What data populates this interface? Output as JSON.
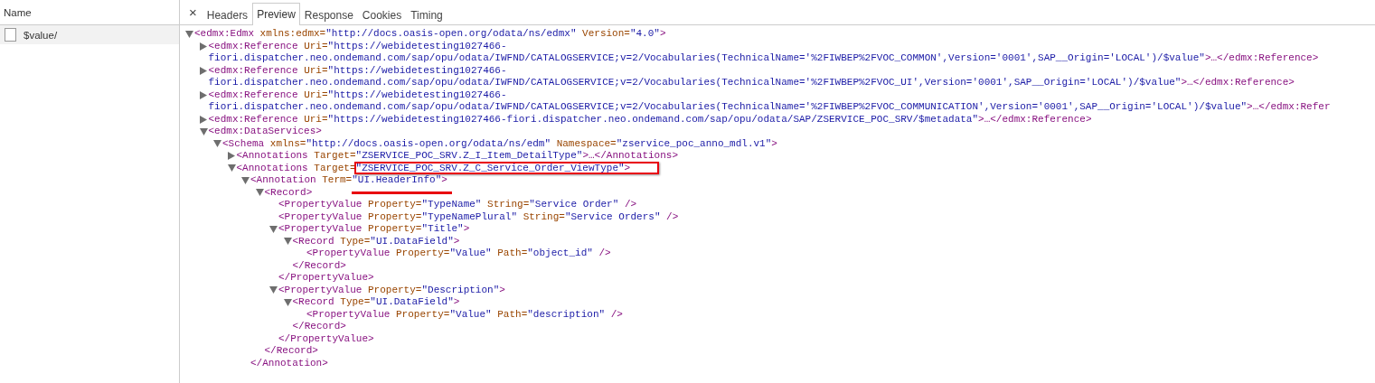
{
  "requests": {
    "column": "Name",
    "items": [
      {
        "name": "$value/",
        "selected": true
      }
    ]
  },
  "tabs": {
    "close": "×",
    "items": [
      {
        "label": "Headers",
        "selected": false
      },
      {
        "label": "Preview",
        "selected": true
      },
      {
        "label": "Response",
        "selected": false
      },
      {
        "label": "Cookies",
        "selected": false
      },
      {
        "label": "Timing",
        "selected": false
      }
    ]
  },
  "document": {
    "expanded": true,
    "tag": "<edmx:Edmx",
    "attrs": [
      {
        "name": "xmlns:edmx=",
        "value": "\"http://docs.oasis-open.org/odata/ns/edmx\""
      },
      {
        "name": "Version=",
        "value": "\"4.0\""
      }
    ],
    "end": ">",
    "children": [
      {
        "expanded": false,
        "tag": "<edmx:Reference",
        "attrs": [
          {
            "name": "Uri=",
            "value": "\"https://webidetesting1027466-fiori.dispatcher.neo.ondemand.com/sap/opu/odata/IWFND/CATALOGSERVICE;v=2/Vocabularies(TechnicalName='%2FIWBEP%2FVOC_COMMON',Version='0001',SAP__Origin='LOCAL')/$value\""
          }
        ],
        "end": ">…</edmx:Reference>"
      },
      {
        "expanded": false,
        "tag": "<edmx:Reference",
        "attrs": [
          {
            "name": "Uri=",
            "value": "\"https://webidetesting1027466-fiori.dispatcher.neo.ondemand.com/sap/opu/odata/IWFND/CATALOGSERVICE;v=2/Vocabularies(TechnicalName='%2FIWBEP%2FVOC_UI',Version='0001',SAP__Origin='LOCAL')/$value\""
          }
        ],
        "end": ">…</edmx:Reference>"
      },
      {
        "expanded": false,
        "tag": "<edmx:Reference",
        "attrs": [
          {
            "name": "Uri=",
            "value": "\"https://webidetesting1027466-fiori.dispatcher.neo.ondemand.com/sap/opu/odata/IWFND/CATALOGSERVICE;v=2/Vocabularies(TechnicalName='%2FIWBEP%2FVOC_COMMUNICATION',Version='0001',SAP__Origin='LOCAL')/$value\""
          }
        ],
        "end": ">…</edmx:Refer"
      },
      {
        "expanded": false,
        "tag": "<edmx:Reference",
        "attrs": [
          {
            "name": "Uri=",
            "value": "\"https://webidetesting1027466-fiori.dispatcher.neo.ondemand.com/sap/opu/odata/SAP/ZSERVICE_POC_SRV/$metadata\""
          }
        ],
        "end": ">…</edmx:Reference>"
      },
      {
        "expanded": true,
        "tag": "<edmx:DataServices",
        "end": ">",
        "children": [
          {
            "expanded": true,
            "tag": "<Schema",
            "attrs": [
              {
                "name": "xmlns=",
                "value": "\"http://docs.oasis-open.org/odata/ns/edm\""
              },
              {
                "name": "Namespace=",
                "value": "\"zservice_poc_anno_mdl.v1\""
              }
            ],
            "end": ">",
            "children": [
              {
                "expanded": false,
                "tag": "<Annotations",
                "attrs": [
                  {
                    "name": "Target=",
                    "value": "\"ZSERVICE_POC_SRV.Z_I_Item_DetailType\""
                  }
                ],
                "end": ">…</Annotations>"
              },
              {
                "expanded": true,
                "tag": "<Annotations",
                "attrs": [
                  {
                    "name": "Target=",
                    "value": "\"ZSERVICE_POC_SRV.Z_C_Service_Order_ViewType\"",
                    "boxed": true
                  }
                ],
                "end": ">",
                "children": [
                  {
                    "expanded": true,
                    "tag": "<Annotation",
                    "attrs": [
                      {
                        "name": "Term=",
                        "value": "\"UI.HeaderInfo\"",
                        "underlined": true
                      }
                    ],
                    "end": ">",
                    "children": [
                      {
                        "expanded": true,
                        "tag": "<Record",
                        "end": ">",
                        "children": [
                          {
                            "tag": "<PropertyValue",
                            "attrs": [
                              {
                                "name": "Property=",
                                "value": "\"TypeName\""
                              },
                              {
                                "name": "String=",
                                "value": "\"Service Order\""
                              }
                            ],
                            "end": " />"
                          },
                          {
                            "tag": "<PropertyValue",
                            "attrs": [
                              {
                                "name": "Property=",
                                "value": "\"TypeNamePlural\""
                              },
                              {
                                "name": "String=",
                                "value": "\"Service Orders\""
                              }
                            ],
                            "end": " />"
                          },
                          {
                            "expanded": true,
                            "tag": "<PropertyValue",
                            "attrs": [
                              {
                                "name": "Property=",
                                "value": "\"Title\""
                              }
                            ],
                            "end": ">",
                            "children": [
                              {
                                "expanded": true,
                                "tag": "<Record",
                                "attrs": [
                                  {
                                    "name": "Type=",
                                    "value": "\"UI.DataField\""
                                  }
                                ],
                                "end": ">",
                                "children": [
                                  {
                                    "tag": "<PropertyValue",
                                    "attrs": [
                                      {
                                        "name": "Property=",
                                        "value": "\"Value\""
                                      },
                                      {
                                        "name": "Path=",
                                        "value": "\"object_id\""
                                      }
                                    ],
                                    "end": " />"
                                  }
                                ],
                                "closing": "</Record>"
                              }
                            ],
                            "closing": "</PropertyValue>"
                          },
                          {
                            "expanded": true,
                            "tag": "<PropertyValue",
                            "attrs": [
                              {
                                "name": "Property=",
                                "value": "\"Description\""
                              }
                            ],
                            "end": ">",
                            "children": [
                              {
                                "expanded": true,
                                "tag": "<Record",
                                "attrs": [
                                  {
                                    "name": "Type=",
                                    "value": "\"UI.DataField\""
                                  }
                                ],
                                "end": ">",
                                "children": [
                                  {
                                    "tag": "<PropertyValue",
                                    "attrs": [
                                      {
                                        "name": "Property=",
                                        "value": "\"Value\""
                                      },
                                      {
                                        "name": "Path=",
                                        "value": "\"description\""
                                      }
                                    ],
                                    "end": " />"
                                  }
                                ],
                                "closing": "</Record>"
                              }
                            ],
                            "closing": "</PropertyValue>"
                          }
                        ],
                        "closing": "</Record>"
                      }
                    ],
                    "closing": "</Annotation>"
                  }
                ]
              }
            ]
          }
        ]
      }
    ]
  }
}
